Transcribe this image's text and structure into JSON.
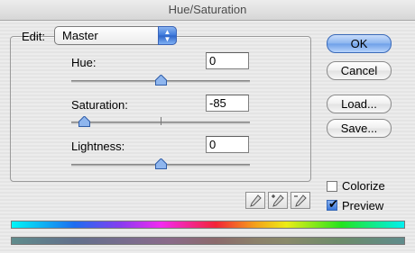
{
  "window": {
    "title": "Hue/Saturation"
  },
  "edit": {
    "label": "Edit:",
    "selected": "Master"
  },
  "adjustments": {
    "hue": {
      "label": "Hue:",
      "value": "0",
      "slider_fraction": 0.5
    },
    "saturation": {
      "label": "Saturation:",
      "value": "-85",
      "slider_fraction": 0.075
    },
    "lightness": {
      "label": "Lightness:",
      "value": "0",
      "slider_fraction": 0.5
    }
  },
  "buttons": {
    "ok": "OK",
    "cancel": "Cancel",
    "load": "Load...",
    "save": "Save..."
  },
  "options": {
    "colorize": {
      "label": "Colorize",
      "checked": false
    },
    "preview": {
      "label": "Preview",
      "checked": true
    }
  },
  "icons": {
    "popup_arrows": "up-down-arrows-icon",
    "eyedropper": "eyedropper-icon",
    "eyedropper_add": "eyedropper-plus-icon",
    "eyedropper_subtract": "eyedropper-minus-icon",
    "checkmark": "checkmark-icon"
  },
  "colors": {
    "accent": "#3b78db"
  }
}
